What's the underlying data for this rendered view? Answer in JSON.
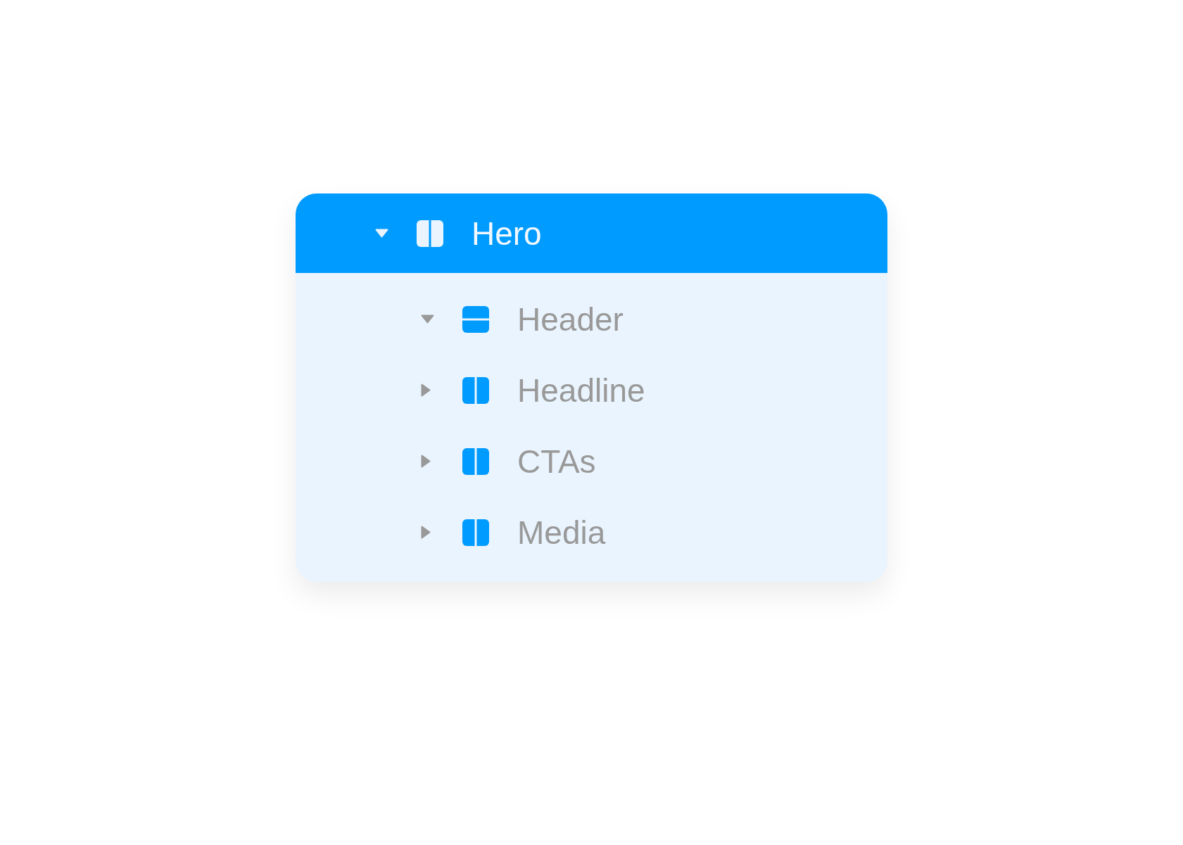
{
  "tree": {
    "items": [
      {
        "label": "Hero",
        "kind": "columns",
        "selected": true,
        "expanded": true,
        "children": [
          {
            "label": "Header",
            "kind": "rows",
            "selected": false,
            "expanded": true
          },
          {
            "label": "Headline",
            "kind": "columns",
            "selected": false,
            "expanded": false
          },
          {
            "label": "CTAs",
            "kind": "columns",
            "selected": false,
            "expanded": false
          },
          {
            "label": "Media",
            "kind": "columns",
            "selected": false,
            "expanded": false
          }
        ]
      }
    ]
  }
}
